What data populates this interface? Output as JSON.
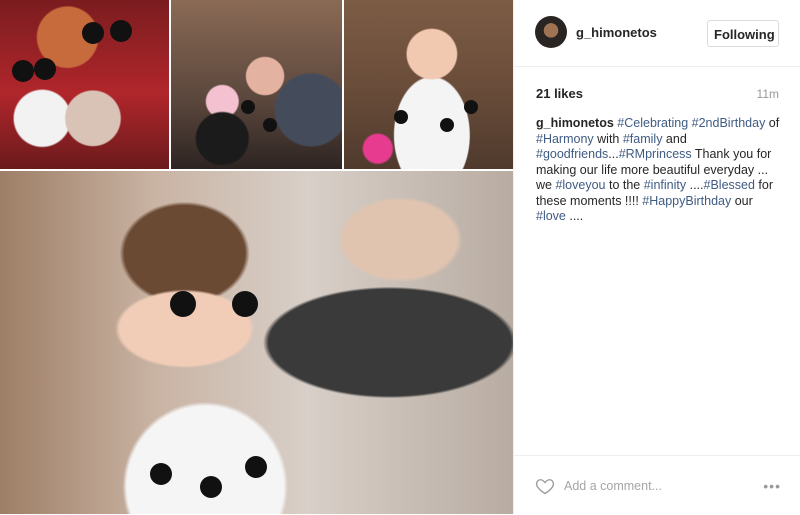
{
  "post": {
    "username": "g_himonetos",
    "follow_label": "Following",
    "likes": "21 likes",
    "time": "11m",
    "caption": {
      "username": "g_himonetos",
      "segments": [
        {
          "text": " ",
          "tag": false
        },
        {
          "text": "#Celebrating",
          "tag": true
        },
        {
          "text": " ",
          "tag": false
        },
        {
          "text": "#2ndBirthday",
          "tag": true
        },
        {
          "text": " of ",
          "tag": false
        },
        {
          "text": "#Harmony",
          "tag": true
        },
        {
          "text": " with ",
          "tag": false
        },
        {
          "text": "#family",
          "tag": true
        },
        {
          "text": " and ",
          "tag": false
        },
        {
          "text": "#goodfriends",
          "tag": true
        },
        {
          "text": "...",
          "tag": false
        },
        {
          "text": "#RMprincess",
          "tag": true
        },
        {
          "text": " Thank you for making our life more beautiful everyday ... we ",
          "tag": false
        },
        {
          "text": "#loveyou",
          "tag": true
        },
        {
          "text": " to the ",
          "tag": false
        },
        {
          "text": "#infinity",
          "tag": true
        },
        {
          "text": " ....",
          "tag": false
        },
        {
          "text": "#Blessed",
          "tag": true
        },
        {
          "text": " for these moments !!!! ",
          "tag": false
        },
        {
          "text": "#HappyBirthday",
          "tag": true
        },
        {
          "text": " our ",
          "tag": false
        },
        {
          "text": "#love",
          "tag": true
        },
        {
          "text": " ....",
          "tag": false
        }
      ]
    },
    "comment_placeholder": "Add a comment...",
    "more_label": "•••"
  },
  "icons": {
    "heart": "heart-outline-icon",
    "more": "ellipsis-icon"
  },
  "colors": {
    "hashtag": "#3f5b83",
    "muted": "#999999",
    "border": "#efefef"
  }
}
